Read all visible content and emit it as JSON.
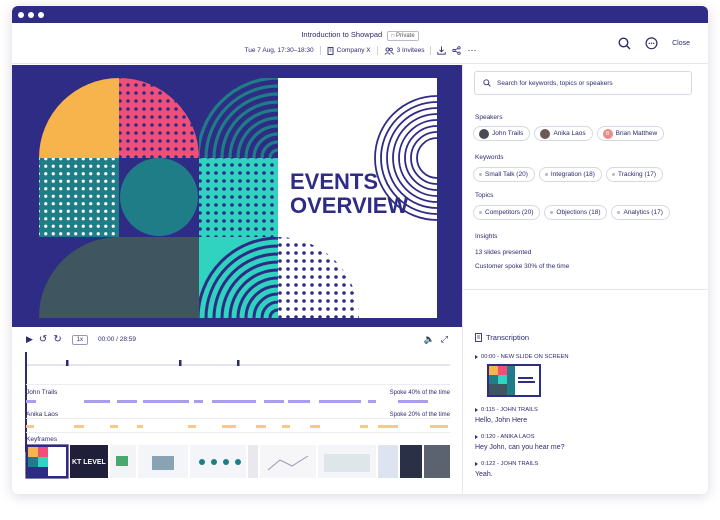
{
  "header": {
    "title": "Introduction to Showpad",
    "badge": "Private",
    "datetime": "Tue 7 Aug, 17:30–18:30",
    "company": "Company X",
    "invitees": "3 Invitees",
    "close_label": "Close"
  },
  "slide": {
    "title_line1": "EVENTS",
    "title_line2": "OVERVIEW",
    "colors": {
      "navy": "#2e2c85",
      "orange": "#f7b44d",
      "pink": "#ef4f79",
      "teal": "#1e7d86",
      "mint": "#2fd3bf",
      "slate": "#3f555f",
      "white": "#ffffff"
    }
  },
  "player": {
    "time": "00:00 / 28:59",
    "speed": "1x"
  },
  "timeline": {
    "speakers": [
      {
        "name": "John Trails",
        "spoke": "Spoke 40% of the time",
        "color": "#a89df0"
      },
      {
        "name": "Anika Laos",
        "spoke": "Spoke 20% of the time",
        "color": "#f6c987"
      }
    ],
    "keyframes_label": "Keyframes",
    "keyframe_partial_text": "KT LEVEL"
  },
  "search": {
    "placeholder": "Search for keywords, topics or speakers"
  },
  "speakers": {
    "label": "Speakers",
    "items": [
      {
        "name": "John Trails",
        "avatar_color": "#4a4a55"
      },
      {
        "name": "Anika Laos",
        "avatar_color": "#6b5a55"
      },
      {
        "name": "Brian Matthew",
        "avatar_color": "#f08a86",
        "initials": "B"
      }
    ]
  },
  "keywords": {
    "label": "Keywords",
    "items": [
      "Small Talk (20)",
      "Integration (18)",
      "Tracking (17)"
    ]
  },
  "topics": {
    "label": "Topics",
    "items": [
      "Competitors (20)",
      "Objections (18)",
      "Analytics (17)"
    ]
  },
  "insights": {
    "label": "Insights",
    "items": [
      "13 slides presented",
      "Customer spoke 30% of the time"
    ]
  },
  "transcription": {
    "title": "Transcription",
    "entries": [
      {
        "stamp": "00:00 - NEW SLIDE ON SCREEN",
        "text": ""
      },
      {
        "stamp": "0:115 - JOHN TRAILS",
        "text": "Hello, John Here"
      },
      {
        "stamp": "0:120 - ANIKA LAOS",
        "text": "Hey John, can you hear me?"
      },
      {
        "stamp": "0:122 - JOHN TRAILS",
        "text": "Yeah."
      }
    ]
  }
}
